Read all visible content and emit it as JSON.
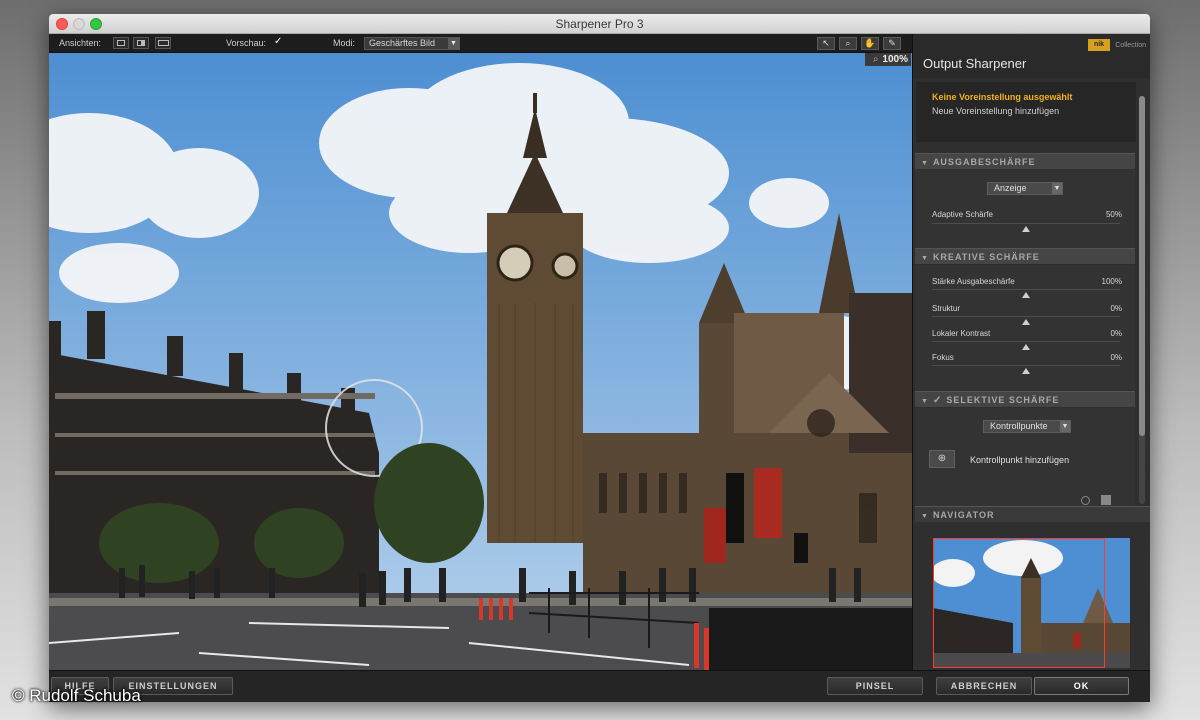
{
  "window": {
    "title": "Sharpener Pro 3"
  },
  "toolbar": {
    "views_label": "Ansichten:",
    "preview_label": "Vorschau:",
    "preview_checked": true,
    "mode_label": "Modi:",
    "mode_value": "Geschärftes Bild",
    "tools": [
      "arrow-pointer-icon",
      "zoom-icon",
      "hand-icon",
      "eyedropper-icon"
    ]
  },
  "canvas": {
    "zoom": "100%"
  },
  "panel": {
    "title": "Output Sharpener",
    "brand": "nik",
    "brand_sub": "Collection",
    "preset_selected": "Keine Voreinstellung ausgewählt",
    "preset_add": "Neue Voreinstellung hinzufügen",
    "sections": {
      "ausgabe": {
        "title": "AUSGABESCHÄRFE",
        "dropdown": "Anzeige",
        "sliders": [
          {
            "label": "Adaptive Schärfe",
            "value": "50%"
          }
        ]
      },
      "kreativ": {
        "title": "KREATIVE SCHÄRFE",
        "sliders": [
          {
            "label": "Stärke Ausgabeschärfe",
            "value": "100%"
          },
          {
            "label": "Struktur",
            "value": "0%"
          },
          {
            "label": "Lokaler Kontrast",
            "value": "0%"
          },
          {
            "label": "Fokus",
            "value": "0%"
          }
        ]
      },
      "selektiv": {
        "title": "SELEKTIVE SCHÄRFE",
        "enabled": true,
        "dropdown": "Kontrollpunkte",
        "add_point": "Kontrollpunkt hinzufügen"
      },
      "navigator": {
        "title": "NAVIGATOR"
      }
    }
  },
  "bottom": {
    "help": "HILFE",
    "settings": "EINSTELLUNGEN",
    "brush": "PINSEL",
    "cancel": "ABBRECHEN",
    "ok": "OK"
  },
  "copyright": "© Rudolf Schuba",
  "colors": {
    "accent": "#f0b020",
    "nav_frame": "#ff3b2b",
    "nik_logo": "#d6a21e"
  }
}
